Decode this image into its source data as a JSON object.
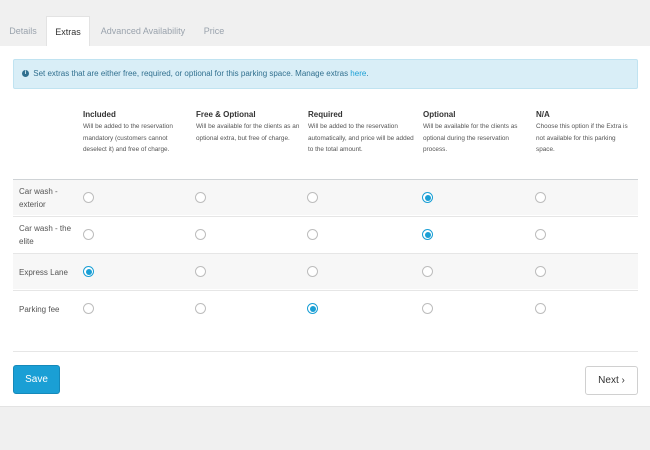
{
  "tabs": [
    {
      "label": "Details",
      "active": false
    },
    {
      "label": "Extras",
      "active": true
    },
    {
      "label": "Advanced Availability",
      "active": false
    },
    {
      "label": "Price",
      "active": false
    }
  ],
  "alert": {
    "icon": "info-circle-icon",
    "text": "Set extras that are either free, required, or optional for this parking space. Manage extras ",
    "link": "here",
    "suffix": "."
  },
  "columns": [
    {
      "title": "Included",
      "desc": "Will be added to the reservation mandatory (customers cannot deselect it) and free of charge."
    },
    {
      "title": "Free & Optional",
      "desc": "Will be available for the clients as an optional extra, but free of charge."
    },
    {
      "title": "Required",
      "desc": "Will be added to the reservation automatically, and price will be added to the total amount."
    },
    {
      "title": "Optional",
      "desc": "Will be available for the clients as optional during the reservation process."
    },
    {
      "title": "N/A",
      "desc": "Choose this option if the Extra is not available for this parking space."
    }
  ],
  "rows": [
    {
      "label": "Car wash - exterior",
      "selected": "Optional"
    },
    {
      "label": "Car wash - the elite",
      "selected": "Optional"
    },
    {
      "label": "Express Lane",
      "selected": "Included"
    },
    {
      "label": "Parking fee",
      "selected": "Required"
    }
  ],
  "buttons": {
    "save": "Save",
    "next": "Next ›"
  },
  "colors": {
    "accent": "#1a9fd5",
    "alert_bg": "#d9eef7"
  }
}
